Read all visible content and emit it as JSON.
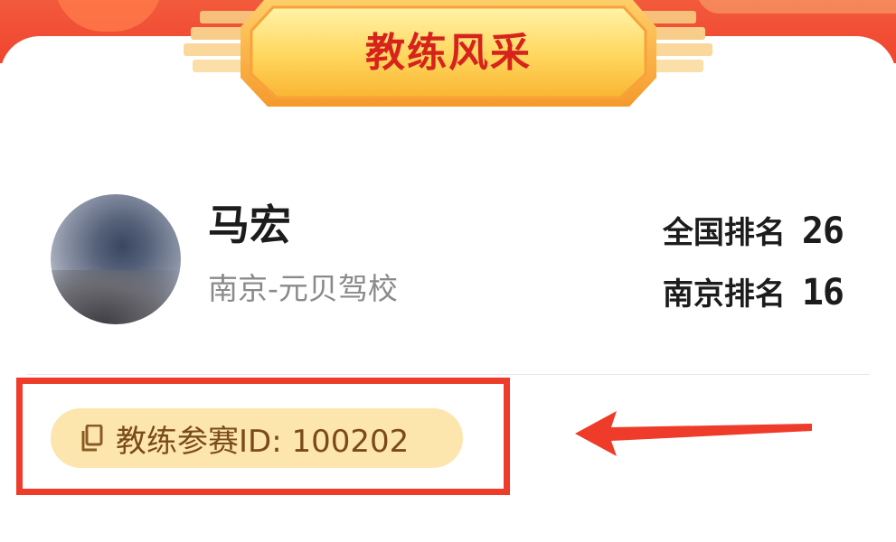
{
  "header": {
    "title": "教练风采"
  },
  "coach": {
    "name": "马宏",
    "school": "南京-元贝驾校",
    "national_rank_label": "全国排名",
    "national_rank_value": "26",
    "city_rank_label": "南京排名",
    "city_rank_value": "16",
    "competition_id_text": "教练参赛ID: 100202"
  },
  "icons": {
    "copy": "copy-icon",
    "arrow": "left-arrow-icon"
  },
  "colors": {
    "header_red": "#f0452f",
    "title_red": "#d6231c",
    "pill_bg": "#fde6ad",
    "pill_text": "#7a4a1a",
    "highlight_red": "#ee3b2a"
  }
}
